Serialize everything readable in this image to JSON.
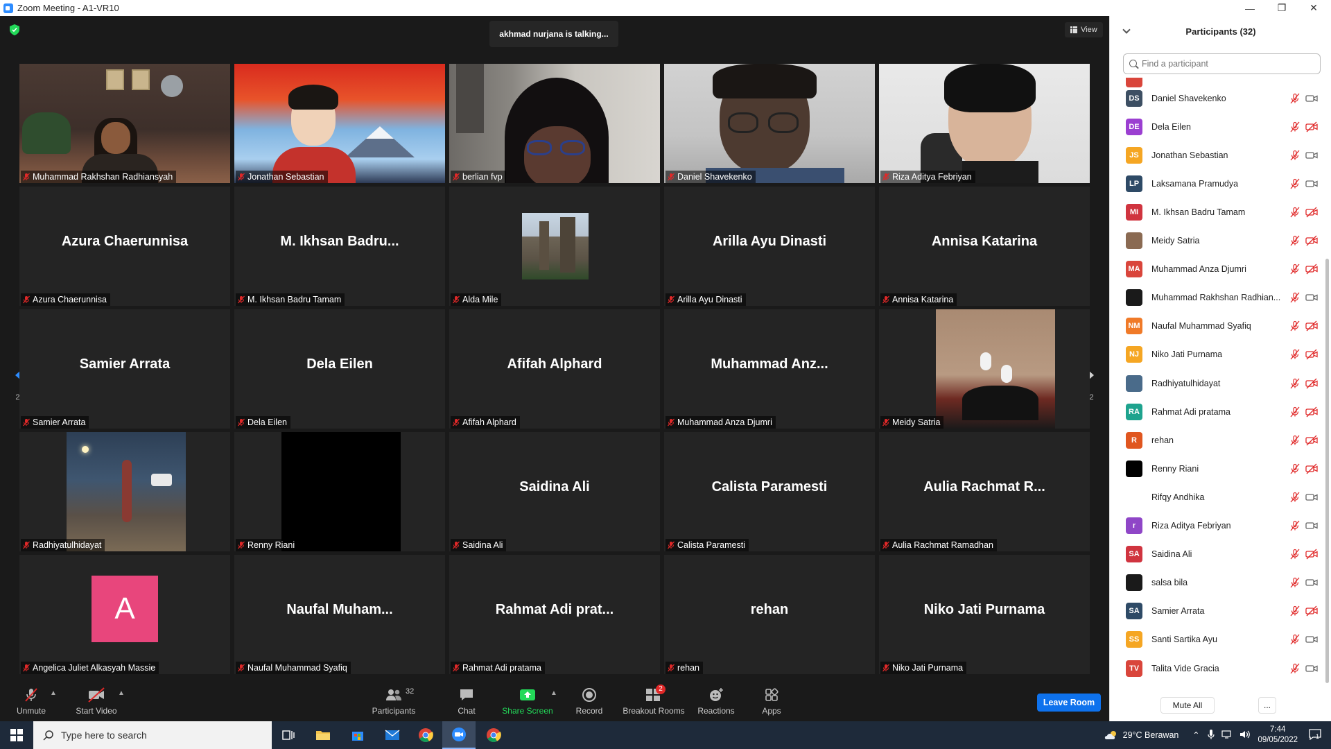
{
  "window": {
    "title": "Zoom Meeting - A1-VR10"
  },
  "main": {
    "talking": "akhmad nurjana is talking...",
    "view_label": "View",
    "page_indicator_left": "2/2",
    "page_indicator_right": "2/2"
  },
  "tiles": [
    {
      "label": "Muhammad Rakhshan Radhiansyah",
      "big": "",
      "kind": "video-room"
    },
    {
      "label": "Jonathan Sebastian",
      "big": "",
      "kind": "video-autumn"
    },
    {
      "label": "berlian fvp",
      "big": "",
      "kind": "video-room2"
    },
    {
      "label": "Daniel Shavekenko",
      "big": "",
      "kind": "video-plain"
    },
    {
      "label": "Riza Aditya Febriyan",
      "big": "",
      "kind": "video-plain2"
    },
    {
      "label": "Azura Chaerunnisa",
      "big": "Azura Chaerunnisa",
      "kind": "name"
    },
    {
      "label": "M. Ikhsan Badru Tamam",
      "big": "M. Ikhsan Badru...",
      "kind": "name"
    },
    {
      "label": "Alda Mile",
      "big": "",
      "kind": "photo-building"
    },
    {
      "label": "Arilla Ayu Dinasti",
      "big": "Arilla Ayu Dinasti",
      "kind": "name"
    },
    {
      "label": "Annisa Katarina",
      "big": "Annisa Katarina",
      "kind": "name"
    },
    {
      "label": "Samier Arrata",
      "big": "Samier Arrata",
      "kind": "name"
    },
    {
      "label": "Dela Eilen",
      "big": "Dela Eilen",
      "kind": "name"
    },
    {
      "label": "Afifah Alphard",
      "big": "Afifah Alphard",
      "kind": "name"
    },
    {
      "label": "Muhammad Anza Djumri",
      "big": "Muhammad  Anz...",
      "kind": "name"
    },
    {
      "label": "Meidy Satria",
      "big": "",
      "kind": "photo-shoes"
    },
    {
      "label": "Radhiyatulhidayat",
      "big": "",
      "kind": "photo-night"
    },
    {
      "label": "Renny Riani",
      "big": "",
      "kind": "photo-black"
    },
    {
      "label": "Saidina Ali",
      "big": "Saidina Ali",
      "kind": "name"
    },
    {
      "label": "Calista Paramesti",
      "big": "Calista Paramesti",
      "kind": "name"
    },
    {
      "label": "Aulia Rachmat Ramadhan",
      "big": "Aulia Rachmat R...",
      "kind": "name"
    },
    {
      "label": "Angelica Juliet Alkasyah Massie",
      "big": "A",
      "kind": "avatar-letter"
    },
    {
      "label": "Naufal Muhammad Syafiq",
      "big": "Naufal  Muham...",
      "kind": "name"
    },
    {
      "label": "Rahmat Adi pratama",
      "big": "Rahmat Adi prat...",
      "kind": "name"
    },
    {
      "label": "rehan",
      "big": "rehan",
      "kind": "name"
    },
    {
      "label": "Niko Jati Purnama",
      "big": "Niko Jati Purnama",
      "kind": "name"
    }
  ],
  "toolbar": {
    "unmute": "Unmute",
    "start_video": "Start Video",
    "participants": "Participants",
    "participants_count": "32",
    "chat": "Chat",
    "share_screen": "Share Screen",
    "record": "Record",
    "breakout_rooms": "Breakout Rooms",
    "breakout_badge": "2",
    "reactions": "Reactions",
    "apps": "Apps",
    "leave_room": "Leave Room"
  },
  "panel": {
    "title": "Participants (32)",
    "search_placeholder": "Find a participant",
    "mute_all": "Mute All",
    "more": "...",
    "participants": [
      {
        "initials": "DS",
        "name": "Daniel Shavekenko",
        "color": "#3d4f63",
        "cam_off": false
      },
      {
        "initials": "DE",
        "name": "Dela Eilen",
        "color": "#9b3fd1",
        "cam_off": true
      },
      {
        "initials": "JS",
        "name": "Jonathan Sebastian",
        "color": "#f5a623",
        "cam_off": false
      },
      {
        "initials": "LP",
        "name": "Laksamana Pramudya",
        "color": "#2e4a66",
        "cam_off": false
      },
      {
        "initials": "MI",
        "name": "M. Ikhsan Badru Tamam",
        "color": "#d0343f",
        "cam_off": true
      },
      {
        "initials": "",
        "name": "Meidy Satria",
        "color": "#8a6a52",
        "cam_off": true
      },
      {
        "initials": "MA",
        "name": "Muhammad Anza Djumri",
        "color": "#d9453b",
        "cam_off": true
      },
      {
        "initials": "",
        "name": "Muhammad Rakhshan Radhian...",
        "color": "#1a1a1a",
        "cam_off": false
      },
      {
        "initials": "NM",
        "name": "Naufal Muhammad Syafiq",
        "color": "#f07a28",
        "cam_off": true
      },
      {
        "initials": "NJ",
        "name": "Niko Jati Purnama",
        "color": "#f5a623",
        "cam_off": true
      },
      {
        "initials": "",
        "name": "Radhiyatulhidayat",
        "color": "#4a6b8a",
        "cam_off": true
      },
      {
        "initials": "RA",
        "name": "Rahmat Adi pratama",
        "color": "#1ea38e",
        "cam_off": true
      },
      {
        "initials": "R",
        "name": "rehan",
        "color": "#e0561f",
        "cam_off": true
      },
      {
        "initials": "",
        "name": "Renny Riani",
        "color": "#000000",
        "cam_off": true
      },
      {
        "initials": "",
        "name": "Rifqy Andhika",
        "color": "#ffffff",
        "cam_off": false
      },
      {
        "initials": "r",
        "name": "Riza Aditya Febriyan",
        "color": "#8f46c7",
        "cam_off": false
      },
      {
        "initials": "SA",
        "name": "Saidina Ali",
        "color": "#d0343f",
        "cam_off": true
      },
      {
        "initials": "",
        "name": "salsa bila",
        "color": "#1a1a1a",
        "cam_off": false
      },
      {
        "initials": "SA",
        "name": "Samier Arrata",
        "color": "#2e4a66",
        "cam_off": true
      },
      {
        "initials": "SS",
        "name": "Santi Sartika Ayu",
        "color": "#f5a623",
        "cam_off": false
      },
      {
        "initials": "TV",
        "name": "Talita Vide Gracia",
        "color": "#d9453b",
        "cam_off": false
      }
    ]
  },
  "taskbar": {
    "search_placeholder": "Type here to search",
    "weather": "29°C  Berawan",
    "time": "7:44",
    "date": "09/05/2022",
    "notifications": "1"
  }
}
